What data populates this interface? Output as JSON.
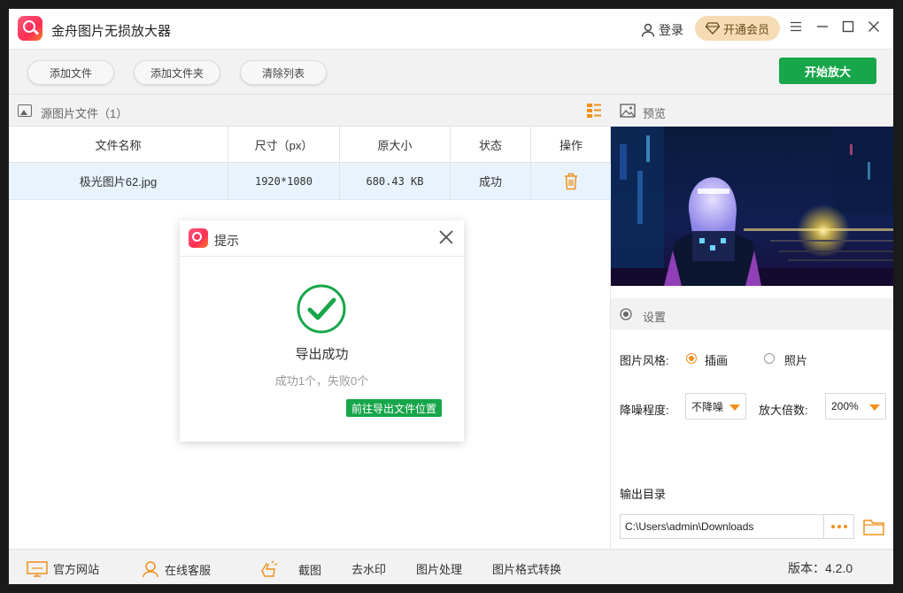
{
  "app": {
    "title": "金舟图片无损放大器",
    "login_label": "登录",
    "vip_label": "开通会员"
  },
  "toolbar": {
    "add_file": "添加文件",
    "add_folder": "添加文件夹",
    "clear_list": "清除列表",
    "start": "开始放大"
  },
  "source": {
    "title": "源图片文件（1）",
    "columns": [
      "文件名称",
      "尺寸（px）",
      "原大小",
      "状态",
      "操作"
    ],
    "rows": [
      {
        "name": "极光图片62.jpg",
        "size": "1920*1080",
        "orig_size": "680.43 KB",
        "status": "成功"
      }
    ]
  },
  "dialog": {
    "title": "提示",
    "message": "导出成功",
    "detail": "成功1个，失败0个",
    "goto_label": "前往导出文件位置"
  },
  "preview": {
    "title": "预览"
  },
  "settings": {
    "title": "设置",
    "style_label": "图片风格:",
    "style_options": [
      "插画",
      "照片"
    ],
    "style_selected": "插画",
    "denoise_label": "降噪程度:",
    "denoise_value": "不降噪",
    "scale_label": "放大倍数:",
    "scale_value": "200%",
    "output_label": "输出目录",
    "output_path": "C:\\Users\\admin\\Downloads"
  },
  "statusbar": {
    "website": "官方网站",
    "support": "在线客服",
    "screenshot": "截图",
    "watermark": "去水印",
    "image_process": "图片处理",
    "format_convert": "图片格式转换",
    "version": "版本：4.2.0"
  },
  "colors": {
    "accent_green": "#18a64a",
    "accent_orange": "#f0901c",
    "vip_gold": "#f5dcb5",
    "row_selected": "#e8f3fd"
  }
}
